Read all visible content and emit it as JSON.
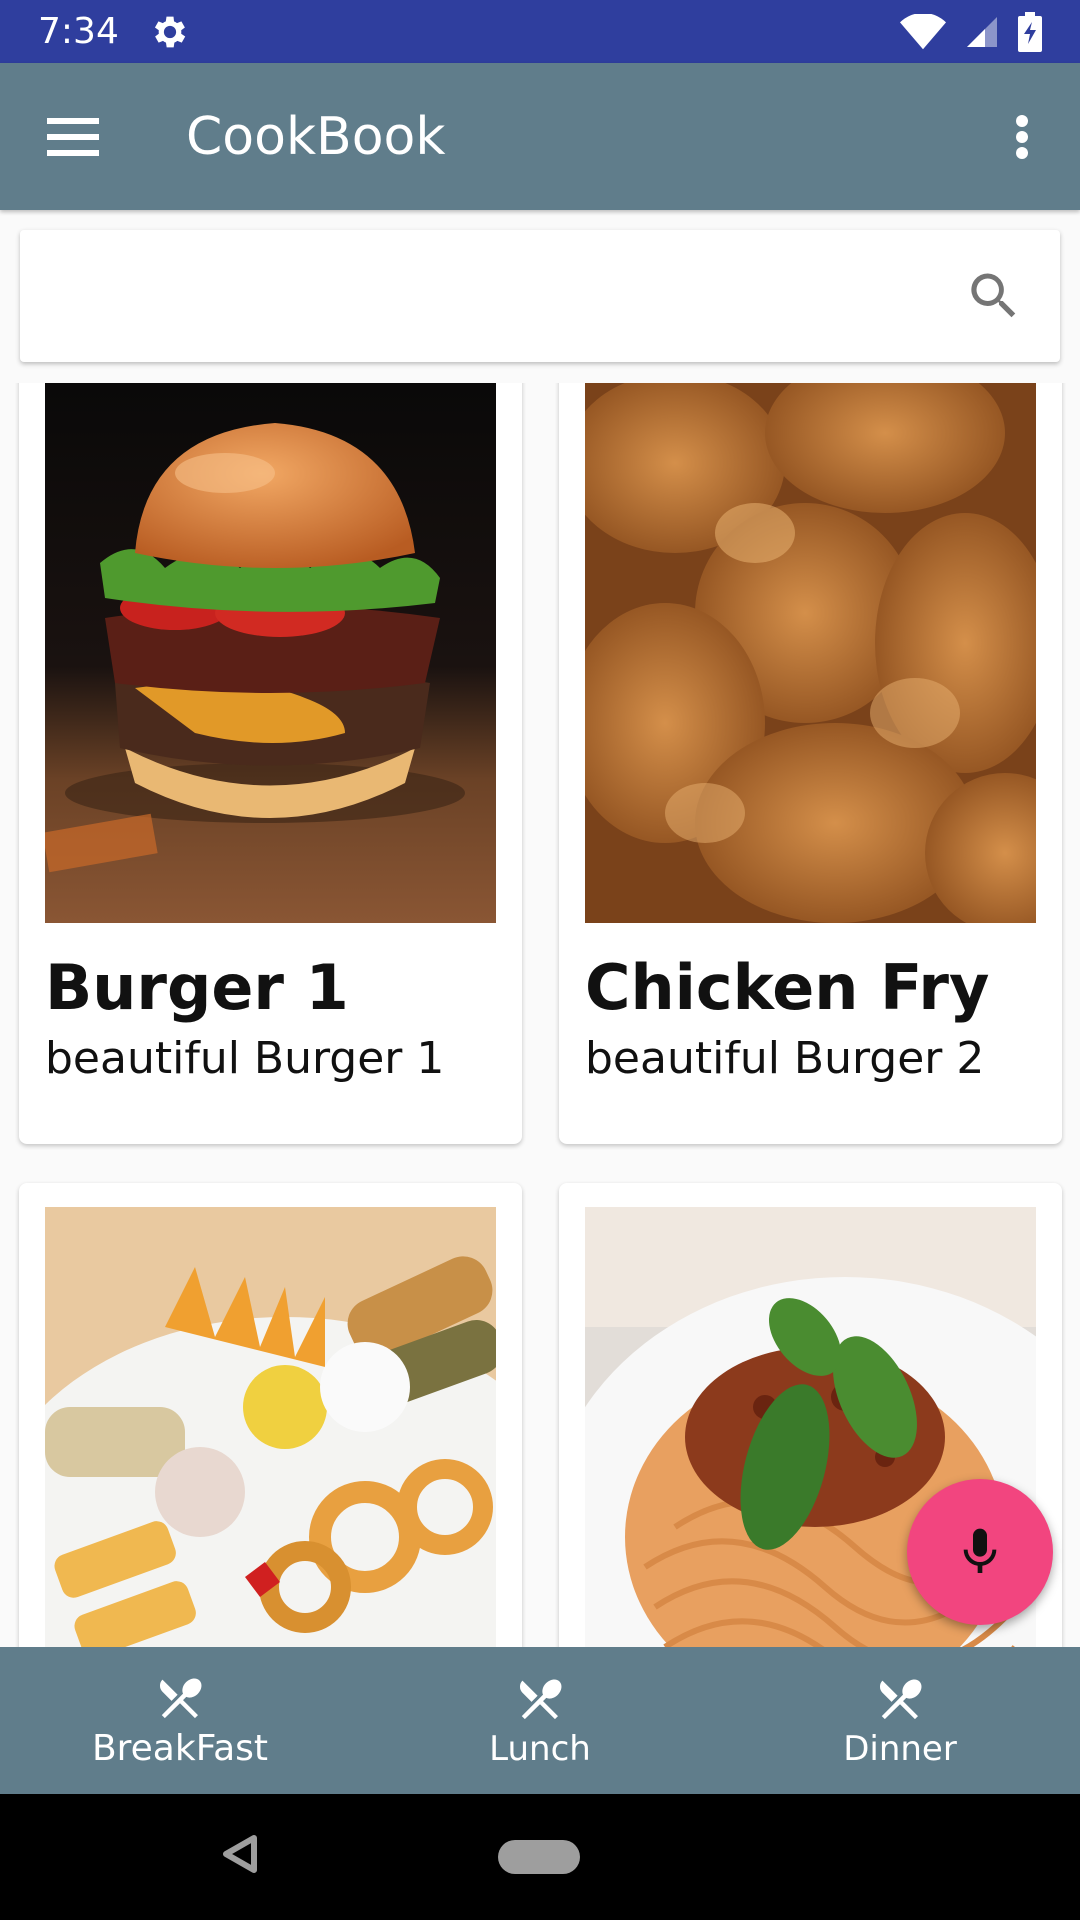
{
  "status_bar": {
    "time": "7:34"
  },
  "app_bar": {
    "title": "CookBook"
  },
  "search": {
    "placeholder": "",
    "value": ""
  },
  "recipes": [
    {
      "title": "Burger 1",
      "subtitle": "beautiful Burger 1",
      "image": "burger"
    },
    {
      "title": "Chicken Fry",
      "subtitle": "beautiful Burger 2",
      "image": "fried-chicken"
    },
    {
      "title": "",
      "subtitle": "",
      "image": "snack-platter"
    },
    {
      "title": "",
      "subtitle": "",
      "image": "spaghetti-bolognese"
    }
  ],
  "bottom_nav": [
    {
      "label": "BreakFast",
      "icon": "utensils-icon",
      "active": true
    },
    {
      "label": "Lunch",
      "icon": "utensils-icon",
      "active": false
    },
    {
      "label": "Dinner",
      "icon": "utensils-icon",
      "active": false
    }
  ],
  "colors": {
    "status_bar": "#2f3e9e",
    "app_bar": "#607d8b",
    "fab": "#f2457f"
  }
}
